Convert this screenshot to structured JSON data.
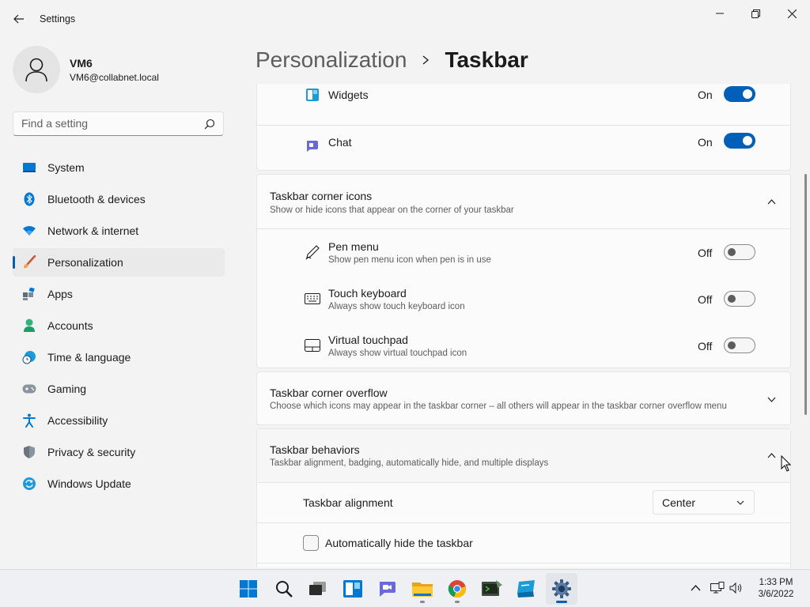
{
  "app": {
    "title": "Settings"
  },
  "user": {
    "name": "VM6",
    "email": "VM6@collabnet.local"
  },
  "search": {
    "placeholder": "Find a setting"
  },
  "sidebar": {
    "items": [
      {
        "label": "System",
        "icon": "system-icon"
      },
      {
        "label": "Bluetooth & devices",
        "icon": "bluetooth-icon"
      },
      {
        "label": "Network & internet",
        "icon": "wifi-icon"
      },
      {
        "label": "Personalization",
        "icon": "brush-icon",
        "active": true
      },
      {
        "label": "Apps",
        "icon": "apps-icon"
      },
      {
        "label": "Accounts",
        "icon": "person-icon"
      },
      {
        "label": "Time & language",
        "icon": "clock-globe-icon"
      },
      {
        "label": "Gaming",
        "icon": "gamepad-icon"
      },
      {
        "label": "Accessibility",
        "icon": "accessibility-icon"
      },
      {
        "label": "Privacy & security",
        "icon": "shield-icon"
      },
      {
        "label": "Windows Update",
        "icon": "update-icon"
      }
    ]
  },
  "header": {
    "parent": "Personalization",
    "current": "Taskbar"
  },
  "taskbar_items": {
    "widgets": {
      "label": "Widgets",
      "state": "On"
    },
    "chat": {
      "label": "Chat",
      "state": "On"
    }
  },
  "corner_icons": {
    "title": "Taskbar corner icons",
    "desc": "Show or hide icons that appear on the corner of your taskbar",
    "items": [
      {
        "label": "Pen menu",
        "desc": "Show pen menu icon when pen is in use",
        "state": "Off"
      },
      {
        "label": "Touch keyboard",
        "desc": "Always show touch keyboard icon",
        "state": "Off"
      },
      {
        "label": "Virtual touchpad",
        "desc": "Always show virtual touchpad icon",
        "state": "Off"
      }
    ]
  },
  "corner_overflow": {
    "title": "Taskbar corner overflow",
    "desc": "Choose which icons may appear in the taskbar corner – all others will appear in the taskbar corner overflow menu"
  },
  "behaviors": {
    "title": "Taskbar behaviors",
    "desc": "Taskbar alignment, badging, automatically hide, and multiple displays",
    "alignment_label": "Taskbar alignment",
    "alignment_value": "Center",
    "autohide_label": "Automatically hide the taskbar"
  },
  "clock": {
    "time": "1:33 PM",
    "date": "3/6/2022"
  },
  "colors": {
    "accent": "#005fb8",
    "background": "#f3f3f3",
    "card": "#fbfbfb"
  }
}
